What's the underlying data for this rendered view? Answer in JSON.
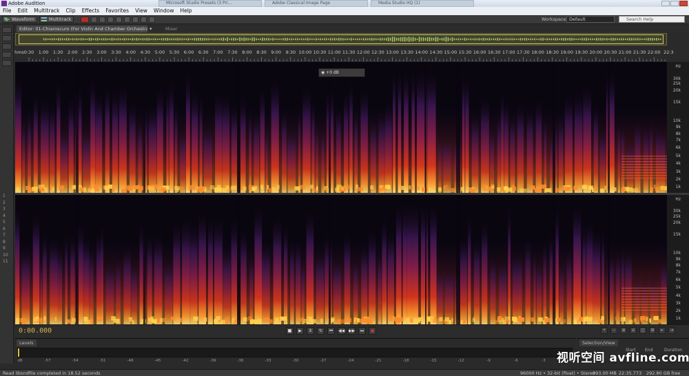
{
  "window": {
    "title": "Adobe Audition",
    "os_tabs": [
      "Microsoft Studio Presets (3 Pri...",
      "Adobe Classical Image Page",
      "Media Studio HQ (1)"
    ]
  },
  "menu": [
    "File",
    "Edit",
    "Multitrack",
    "Clip",
    "Effects",
    "Favorites",
    "View",
    "Window",
    "Help"
  ],
  "toolbar": {
    "waveform_label": "Waveform",
    "multitrack_label": "Multitrack",
    "workspace_label": "Workspace:",
    "workspace_value": "Default",
    "search_placeholder": "Search Help"
  },
  "editor": {
    "tab_label": "Editor: 01-Chiaroscuro (For Violin And Chamber Orchestra)/Rec",
    "mixer_label": "Mixer",
    "hud_value": "+0 dB"
  },
  "ruler": {
    "unit": "hms",
    "labels": [
      "0:30",
      "1:00",
      "1:30",
      "2:00",
      "2:30",
      "3:00",
      "3:30",
      "4:00",
      "4:30",
      "5:00",
      "5:30",
      "6:00",
      "6:30",
      "7:00",
      "7:30",
      "8:00",
      "8:30",
      "9:00",
      "9:30",
      "10:00",
      "10:30",
      "11:00",
      "11:30",
      "12:00",
      "12:30",
      "13:00",
      "13:30",
      "14:00",
      "14:30",
      "15:00",
      "15:30",
      "16:00",
      "16:30",
      "17:00",
      "17:30",
      "18:00",
      "18:30",
      "19:00",
      "19:30",
      "20:00",
      "20:30",
      "21:00",
      "21:30",
      "22:00",
      "22:3"
    ]
  },
  "spectral_axis": {
    "unit": "Hz",
    "labels": [
      "30k",
      "25k",
      "20k",
      "15k",
      "10k",
      "9k",
      "8k",
      "7k",
      "6k",
      "5k",
      "4k",
      "3k",
      "2k",
      "1k"
    ]
  },
  "transport": {
    "timecode": "0:00.000",
    "buttons": [
      "stop",
      "play",
      "pause",
      "loop",
      "go-start",
      "rewind",
      "fast-forward",
      "go-end",
      "record"
    ]
  },
  "levels": {
    "tab_label": "Levels",
    "db_scale": [
      "dB",
      "-57",
      "-54",
      "-51",
      "-48",
      "-45",
      "-42",
      "-39",
      "-36",
      "-33",
      "-30",
      "-27",
      "-24",
      "-21",
      "-18",
      "-15",
      "-12",
      "-9",
      "-6",
      "-3",
      "0"
    ]
  },
  "selection_view": {
    "tab_label": "Selection/View",
    "col_start": "Start",
    "col_end": "End",
    "col_duration": "Duration"
  },
  "status": {
    "message": "Read libsndfile completed in 18.52 seconds",
    "sample_info": "96000 Hz • 32-bit (float) • Stereo",
    "size": "993.00 MB",
    "duration": "22:35.773",
    "disk_free": "292.80 GB free"
  },
  "watermark": "视听空间 avfline.com",
  "colors": {
    "spectral_hot": "#ffd24a",
    "spectral_mid": "#c2301f",
    "spectral_cool": "#3a1650",
    "timecode": "#d9b24a"
  }
}
